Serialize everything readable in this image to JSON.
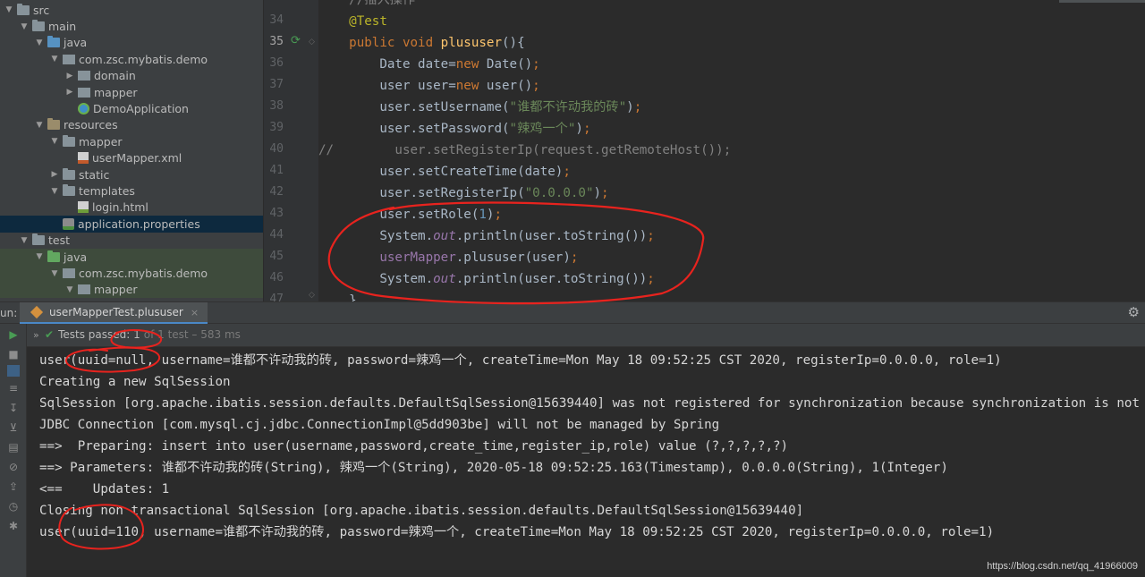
{
  "project_tree": [
    {
      "label": "src",
      "icon": "folder",
      "arrow": "down",
      "indent": 0
    },
    {
      "label": "main",
      "icon": "folder",
      "arrow": "down",
      "indent": 1
    },
    {
      "label": "java",
      "icon": "folder-blue",
      "arrow": "down",
      "indent": 2
    },
    {
      "label": "com.zsc.mybatis.demo",
      "icon": "pkg",
      "arrow": "down",
      "indent": 3
    },
    {
      "label": "domain",
      "icon": "pkg",
      "arrow": "right",
      "indent": 4
    },
    {
      "label": "mapper",
      "icon": "pkg",
      "arrow": "right",
      "indent": 4
    },
    {
      "label": "DemoApplication",
      "icon": "spring",
      "arrow": "none",
      "indent": 4
    },
    {
      "label": "resources",
      "icon": "folder-res",
      "arrow": "down",
      "indent": 2
    },
    {
      "label": "mapper",
      "icon": "folder",
      "arrow": "down",
      "indent": 3
    },
    {
      "label": "userMapper.xml",
      "icon": "xml",
      "arrow": "none",
      "indent": 4
    },
    {
      "label": "static",
      "icon": "folder",
      "arrow": "right",
      "indent": 3
    },
    {
      "label": "templates",
      "icon": "folder",
      "arrow": "down",
      "indent": 3
    },
    {
      "label": "login.html",
      "icon": "html",
      "arrow": "none",
      "indent": 4
    },
    {
      "label": "application.properties",
      "icon": "props",
      "arrow": "none",
      "indent": 3,
      "selected": true
    },
    {
      "label": "test",
      "icon": "folder",
      "arrow": "down",
      "indent": 1
    },
    {
      "label": "java",
      "icon": "folder-green",
      "arrow": "down",
      "indent": 2,
      "green": true
    },
    {
      "label": "com.zsc.mybatis.demo",
      "icon": "pkg",
      "arrow": "down",
      "indent": 3,
      "green": true
    },
    {
      "label": "mapper",
      "icon": "pkg",
      "arrow": "down",
      "indent": 4,
      "green": true
    }
  ],
  "line_numbers": [
    "34",
    "35",
    "36",
    "37",
    "38",
    "39",
    "40",
    "41",
    "42",
    "43",
    "44",
    "45",
    "46",
    "47"
  ],
  "code_lines": [
    [
      {
        "t": "    ",
        "c": ""
      },
      {
        "t": "//插入操作",
        "c": "c"
      }
    ],
    [
      {
        "t": "    ",
        "c": ""
      },
      {
        "t": "@Test",
        "c": "a"
      }
    ],
    [
      {
        "t": "    ",
        "c": ""
      },
      {
        "t": "public void ",
        "c": "k"
      },
      {
        "t": "plususer",
        "c": "f"
      },
      {
        "t": "(){",
        "c": ""
      }
    ],
    [
      {
        "t": "        Date date=",
        "c": ""
      },
      {
        "t": "new ",
        "c": "k"
      },
      {
        "t": "Date()",
        "c": ""
      },
      {
        "t": ";",
        "c": "k"
      }
    ],
    [
      {
        "t": "        user user=",
        "c": ""
      },
      {
        "t": "new ",
        "c": "k"
      },
      {
        "t": "user()",
        "c": ""
      },
      {
        "t": ";",
        "c": "k"
      }
    ],
    [
      {
        "t": "        user.setUsername(",
        "c": ""
      },
      {
        "t": "\"谁都不许动我的砖\"",
        "c": "s"
      },
      {
        "t": ")",
        "c": ""
      },
      {
        "t": ";",
        "c": "k"
      }
    ],
    [
      {
        "t": "        user.setPassword(",
        "c": ""
      },
      {
        "t": "\"辣鸡一个\"",
        "c": "s"
      },
      {
        "t": ")",
        "c": ""
      },
      {
        "t": ";",
        "c": "k"
      }
    ],
    [
      {
        "t": "//        user.setRegisterIp(request.getRemoteHost());",
        "c": "c"
      }
    ],
    [
      {
        "t": "        user.setCreateTime(date)",
        "c": ""
      },
      {
        "t": ";",
        "c": "k"
      }
    ],
    [
      {
        "t": "        user.setRegisterIp(",
        "c": ""
      },
      {
        "t": "\"0.0.0.0\"",
        "c": "s"
      },
      {
        "t": ")",
        "c": ""
      },
      {
        "t": ";",
        "c": "k"
      }
    ],
    [
      {
        "t": "        user.setRole(",
        "c": ""
      },
      {
        "t": "1",
        "c": "n"
      },
      {
        "t": ")",
        "c": ""
      },
      {
        "t": ";",
        "c": "k"
      }
    ],
    [
      {
        "t": "        System.",
        "c": ""
      },
      {
        "t": "out",
        "c": "i"
      },
      {
        "t": ".println(user.toString())",
        "c": ""
      },
      {
        "t": ";",
        "c": "k"
      }
    ],
    [
      {
        "t": "        ",
        "c": ""
      },
      {
        "t": "userMapper",
        "c": "m"
      },
      {
        "t": ".plususer(user)",
        "c": ""
      },
      {
        "t": ";",
        "c": "k"
      }
    ],
    [
      {
        "t": "        System.",
        "c": ""
      },
      {
        "t": "out",
        "c": "i"
      },
      {
        "t": ".println(user.toString())",
        "c": ""
      },
      {
        "t": ";",
        "c": "k"
      }
    ],
    [
      {
        "t": "    }",
        "c": ""
      }
    ]
  ],
  "run_window": {
    "label": "un:",
    "tab_label": "userMapperTest.plususer",
    "tab_close": "×",
    "status_passed": "Tests passed: 1",
    "status_detail": "of 1 test – 583 ms"
  },
  "console_lines": [
    "user(uuid=null, username=谁都不许动我的砖, password=辣鸡一个, createTime=Mon May 18 09:52:25 CST 2020, registerIp=0.0.0.0, role=1)",
    "Creating a new SqlSession",
    "SqlSession [org.apache.ibatis.session.defaults.DefaultSqlSession@15639440] was not registered for synchronization because synchronization is not active",
    "JDBC Connection [com.mysql.cj.jdbc.ConnectionImpl@5dd903be] will not be managed by Spring",
    "==>  Preparing: insert into user(username,password,create_time,register_ip,role) value (?,?,?,?,?)",
    "==> Parameters: 谁都不许动我的砖(String), 辣鸡一个(String), 2020-05-18 09:52:25.163(Timestamp), 0.0.0.0(String), 1(Integer)",
    "<==    Updates: 1",
    "Closing non transactional SqlSession [org.apache.ibatis.session.defaults.DefaultSqlSession@15639440]",
    "user(uuid=110, username=谁都不许动我的砖, password=辣鸡一个, createTime=Mon May 18 09:52:25 CST 2020, registerIp=0.0.0.0, role=1)"
  ],
  "watermark": "https://blog.csdn.net/qq_41966009",
  "colors": {
    "annotation": "#e8231e",
    "keyword": "#cc7832",
    "string": "#6a8759",
    "test_passed": "#499c54"
  }
}
